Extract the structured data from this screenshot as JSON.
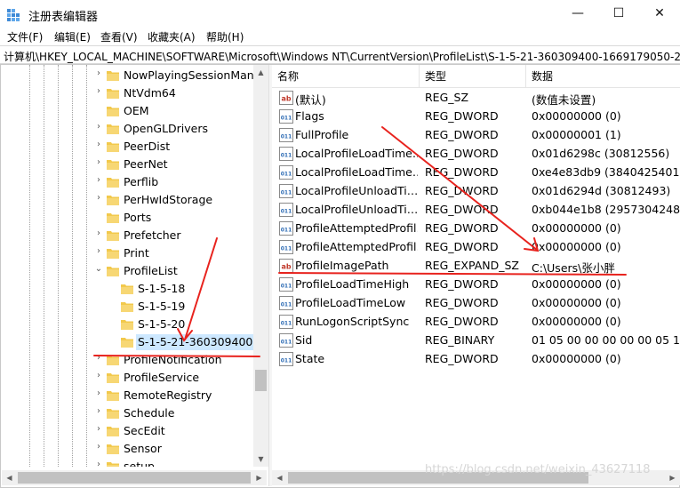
{
  "window": {
    "title": "注册表编辑器",
    "minimize_glyph": "—",
    "maximize_glyph": "☐",
    "close_glyph": "✕"
  },
  "menu": [
    "文件(F)",
    "编辑(E)",
    "查看(V)",
    "收藏夹(A)",
    "帮助(H)"
  ],
  "address": "计算机\\HKEY_LOCAL_MACHINE\\SOFTWARE\\Microsoft\\Windows NT\\CurrentVersion\\ProfileList\\S-1-5-21-360309400-1669179050-27",
  "tree": {
    "items": [
      {
        "label": "NowPlayingSessionMana",
        "expander": "›"
      },
      {
        "label": "NtVdm64",
        "expander": "›"
      },
      {
        "label": "OEM",
        "expander": ""
      },
      {
        "label": "OpenGLDrivers",
        "expander": "›"
      },
      {
        "label": "PeerDist",
        "expander": "›"
      },
      {
        "label": "PeerNet",
        "expander": "›"
      },
      {
        "label": "Perflib",
        "expander": "›"
      },
      {
        "label": "PerHwIdStorage",
        "expander": "›"
      },
      {
        "label": "Ports",
        "expander": ""
      },
      {
        "label": "Prefetcher",
        "expander": "›"
      },
      {
        "label": "Print",
        "expander": "›"
      },
      {
        "label": "ProfileList",
        "expander": "⌄"
      },
      {
        "label": "S-1-5-18",
        "expander": ""
      },
      {
        "label": "S-1-5-19",
        "expander": ""
      },
      {
        "label": "S-1-5-20",
        "expander": ""
      },
      {
        "label": "S-1-5-21-360309400-1",
        "expander": ""
      },
      {
        "label": "ProfileNotification",
        "expander": "›"
      },
      {
        "label": "ProfileService",
        "expander": "›"
      },
      {
        "label": "RemoteRegistry",
        "expander": "›"
      },
      {
        "label": "Schedule",
        "expander": "›"
      },
      {
        "label": "SecEdit",
        "expander": "›"
      },
      {
        "label": "Sensor",
        "expander": "›"
      },
      {
        "label": "setup",
        "expander": "›"
      }
    ]
  },
  "list": {
    "columns": {
      "name": "名称",
      "type": "类型",
      "data": "数据"
    },
    "rows": [
      {
        "icon": "ab",
        "name": "(默认)",
        "type": "REG_SZ",
        "data": "(数值未设置)"
      },
      {
        "icon": "bin",
        "name": "Flags",
        "type": "REG_DWORD",
        "data": "0x00000000 (0)"
      },
      {
        "icon": "bin",
        "name": "FullProfile",
        "type": "REG_DWORD",
        "data": "0x00000001 (1)"
      },
      {
        "icon": "bin",
        "name": "LocalProfileLoadTime…",
        "type": "REG_DWORD",
        "data": "0x01d6298c (30812556)"
      },
      {
        "icon": "bin",
        "name": "LocalProfileLoadTime…",
        "type": "REG_DWORD",
        "data": "0xe4e83db9 (3840425401)"
      },
      {
        "icon": "bin",
        "name": "LocalProfileUnloadTi…",
        "type": "REG_DWORD",
        "data": "0x01d6294d (30812493)"
      },
      {
        "icon": "bin",
        "name": "LocalProfileUnloadTi…",
        "type": "REG_DWORD",
        "data": "0xb044e1b8 (2957304248)"
      },
      {
        "icon": "bin",
        "name": "ProfileAttemptedProfil…",
        "type": "REG_DWORD",
        "data": "0x00000000 (0)"
      },
      {
        "icon": "bin",
        "name": "ProfileAttemptedProfil…",
        "type": "REG_DWORD",
        "data": "0x00000000 (0)"
      },
      {
        "icon": "ab",
        "name": "ProfileImagePath",
        "type": "REG_EXPAND_SZ",
        "data": "C:\\Users\\张小胖"
      },
      {
        "icon": "bin",
        "name": "ProfileLoadTimeHigh",
        "type": "REG_DWORD",
        "data": "0x00000000 (0)"
      },
      {
        "icon": "bin",
        "name": "ProfileLoadTimeLow",
        "type": "REG_DWORD",
        "data": "0x00000000 (0)"
      },
      {
        "icon": "bin",
        "name": "RunLogonScriptSync",
        "type": "REG_DWORD",
        "data": "0x00000000 (0)"
      },
      {
        "icon": "bin",
        "name": "Sid",
        "type": "REG_BINARY",
        "data": "01 05 00 00 00 00 00 05 15 0"
      },
      {
        "icon": "bin",
        "name": "State",
        "type": "REG_DWORD",
        "data": "0x00000000 (0)"
      }
    ]
  },
  "watermark": "https://blog.csdn.net/weixin_43627118",
  "colors": {
    "folder": "#f2c94c",
    "selection": "#cde8ff",
    "annotation": "#e8231e",
    "icon_blue": "#2f6db5",
    "icon_red": "#c0392b"
  }
}
